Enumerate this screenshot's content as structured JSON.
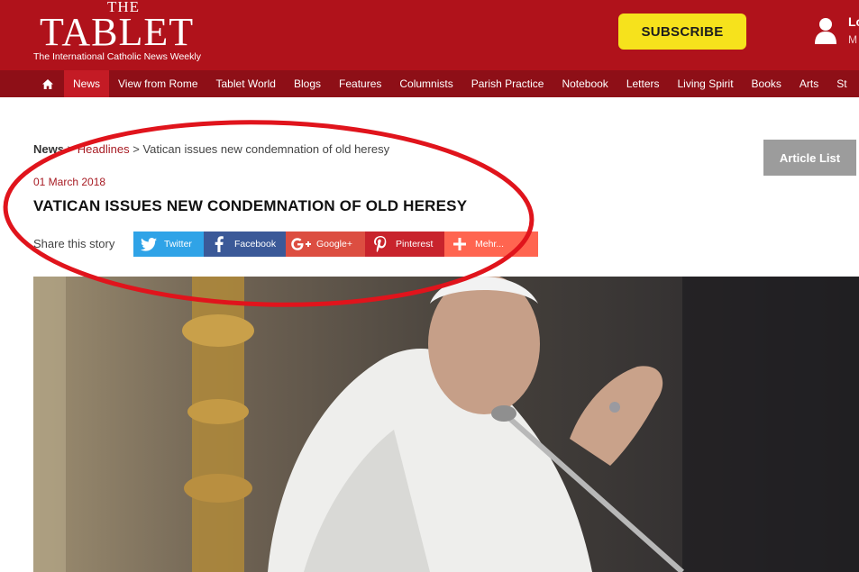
{
  "header": {
    "logo_the": "THE",
    "logo_main": "TABLET",
    "logo_tagline": "The International Catholic News Weekly",
    "subscribe_label": "SUBSCRIBE",
    "login_label": "Lo",
    "login_sub": "M"
  },
  "nav": {
    "items": [
      {
        "label": "News",
        "active": true
      },
      {
        "label": "View from Rome"
      },
      {
        "label": "Tablet World"
      },
      {
        "label": "Blogs"
      },
      {
        "label": "Features"
      },
      {
        "label": "Columnists"
      },
      {
        "label": "Parish Practice"
      },
      {
        "label": "Notebook"
      },
      {
        "label": "Letters"
      },
      {
        "label": "Living Spirit"
      },
      {
        "label": "Books"
      },
      {
        "label": "Arts"
      },
      {
        "label": "St"
      }
    ]
  },
  "breadcrumb": {
    "root": "News",
    "sep1": " > ",
    "section": "Headlines",
    "sep2": " > ",
    "current": "Vatican issues new condemnation of old heresy"
  },
  "article_list_label": "Article List",
  "article": {
    "date": "01 March 2018",
    "title": "VATICAN ISSUES NEW CONDEMNATION OF OLD HERESY"
  },
  "share": {
    "label": "Share this story",
    "buttons": [
      {
        "label": "Twitter",
        "icon": "twitter-icon"
      },
      {
        "label": "Facebook",
        "icon": "facebook-icon"
      },
      {
        "label": "Google+",
        "icon": "google-plus-icon"
      },
      {
        "label": "Pinterest",
        "icon": "pinterest-icon"
      },
      {
        "label": "Mehr...",
        "icon": "plus-icon"
      }
    ]
  },
  "colors": {
    "brand_red": "#b0121b",
    "nav_dark": "#8e0f17",
    "nav_active": "#c41b25",
    "subscribe_yellow": "#f6e21c",
    "highlight_red": "#e0141c"
  }
}
